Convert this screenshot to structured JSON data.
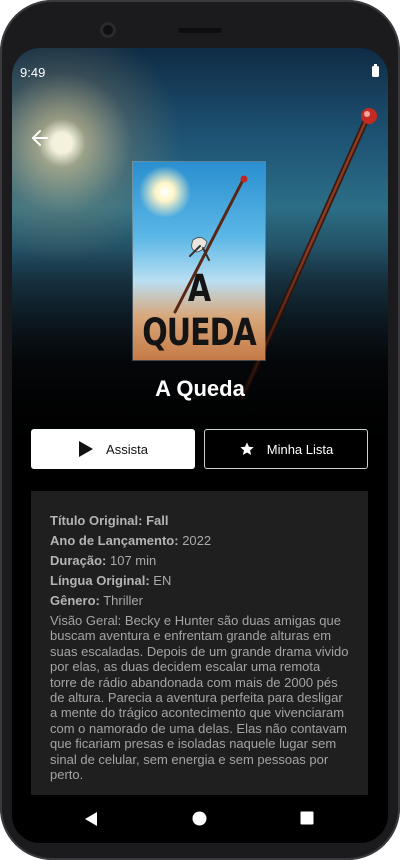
{
  "status_bar": {
    "time": "9:49"
  },
  "movie": {
    "title": "A Queda",
    "poster_text": "A QUEDA"
  },
  "actions": {
    "watch_label": "Assista",
    "list_label": "Minha Lista"
  },
  "details": {
    "original_title_label": "Título Original:",
    "original_title": "Fall",
    "release_year_label": "Ano de Lançamento:",
    "release_year": "2022",
    "duration_label": "Duração:",
    "duration": "107 min",
    "original_language_label": "Língua Original:",
    "original_language": "EN",
    "genre_label": "Gênero:",
    "genre": "Thriller",
    "overview": "Visão Geral: Becky e Hunter são duas amigas que buscam aventura e enfrentam grande alturas em suas escaladas. Depois de um grande drama vivido por elas, as duas decidem escalar uma remota torre de rádio abandonada com mais de 2000 pés de altura. Parecia a aventura perfeita para desligar a mente do trágico acontecimento que vivenciaram com o namorado de uma delas. Elas não contavam que ficariam presas e isoladas naquele lugar sem sinal de celular, sem energia e sem pessoas por perto."
  },
  "icons": {
    "back": "arrow-left-icon",
    "play": "play-icon",
    "star": "star-icon",
    "battery": "battery-icon"
  },
  "colors": {
    "screen_bg": "#000000",
    "card_bg": "#1f1f1f",
    "primary_button": "#ffffff"
  }
}
